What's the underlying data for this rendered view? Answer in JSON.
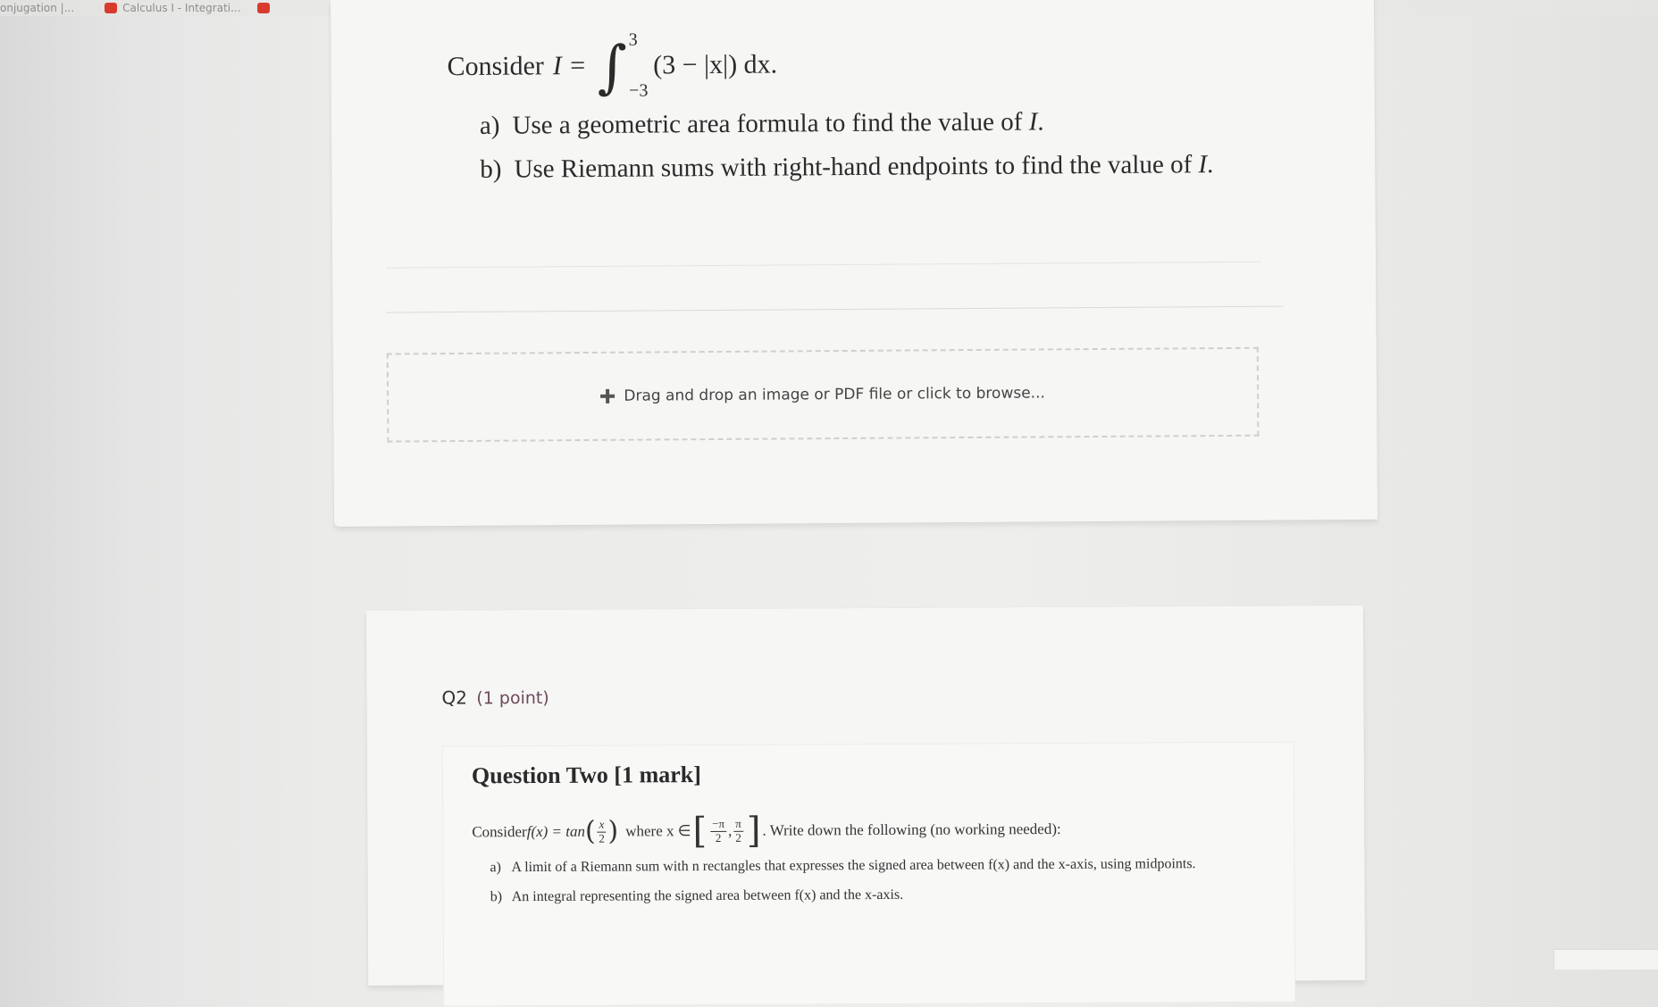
{
  "bookmarks": [
    {
      "label": "onjugation |...",
      "icon": "none"
    },
    {
      "label": "Calculus I - Integrati...",
      "icon": "youtube-icon"
    },
    {
      "label": "",
      "icon": "youtube-icon"
    }
  ],
  "q1": {
    "consider": "Consider",
    "lhs": "I =",
    "int_upper": "3",
    "int_lower": "−3",
    "integrand": "(3 − |x|) dx.",
    "items": [
      {
        "letter": "a)",
        "text": "Use a geometric area formula to find the value of ",
        "var": "I",
        "end": "."
      },
      {
        "letter": "b)",
        "text": "Use Riemann sums with right-hand endpoints to find the value of ",
        "var": "I",
        "end": "."
      }
    ]
  },
  "upload": {
    "label": "Drag and drop an image or PDF file or click to browse..."
  },
  "q2": {
    "header": "Q2",
    "points": "(1 point)",
    "title": "Question Two [1 mark]",
    "consider": "Consider ",
    "func": "f(x) = tan",
    "frac_num": "x",
    "frac_den": "2",
    "where": "where x ∈",
    "int_a_num": "−π",
    "int_a_den": "2",
    "int_b_num": "π",
    "int_b_den": "2",
    "instruction": ". Write down the following (no working needed):",
    "items": [
      {
        "letter": "a)",
        "text": "A limit of a Riemann sum with n rectangles that expresses the signed area between f(x) and the x-axis, using midpoints."
      },
      {
        "letter": "b)",
        "text": "An integral representing the signed area between f(x) and the x-axis."
      }
    ]
  }
}
